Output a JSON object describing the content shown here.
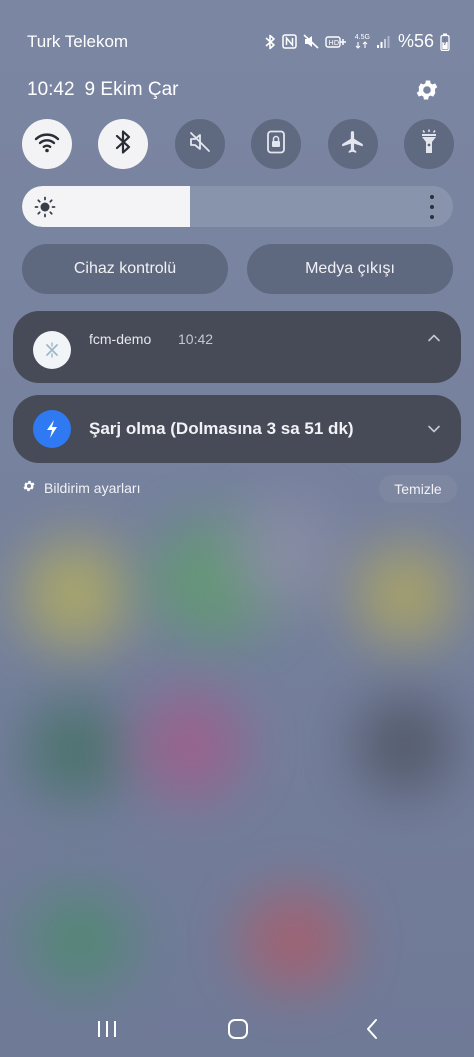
{
  "status_bar": {
    "carrier": "Turk Telekom",
    "icons": [
      "bluetooth-icon",
      "nfc-icon",
      "mute-icon",
      "volte-icon",
      "4g-icon",
      "signal-icon"
    ],
    "network_label": "4.5G",
    "battery": "%56"
  },
  "header": {
    "time": "10:42",
    "date": "9 Ekim Çar"
  },
  "quick_settings": [
    {
      "name": "wifi",
      "icon": "wifi-icon",
      "on": true
    },
    {
      "name": "bluetooth",
      "icon": "bluetooth-icon",
      "on": true
    },
    {
      "name": "sound",
      "icon": "mute-icon",
      "on": false
    },
    {
      "name": "screen-lock",
      "icon": "lock-icon",
      "on": false
    },
    {
      "name": "airplane",
      "icon": "airplane-icon",
      "on": false
    },
    {
      "name": "flashlight",
      "icon": "flashlight-icon",
      "on": false
    }
  ],
  "brightness": {
    "level": 0.39
  },
  "pills": {
    "device_control": "Cihaz kontrolü",
    "media_output": "Medya çıkışı"
  },
  "notifications": [
    {
      "app": "fcm-demo",
      "time": "10:42",
      "icon": "app-icon",
      "expanded": true
    },
    {
      "text": "Şarj olma (Dolmasına 3 sa 51 dk)",
      "icon": "bolt-icon",
      "expanded": false
    }
  ],
  "footer": {
    "settings_label": "Bildirim ayarları",
    "clear_label": "Temizle"
  },
  "colors": {
    "accent_blue": "#2f7af2",
    "card_bg": "#474b57",
    "toggle_on": "#f3f3f6"
  }
}
